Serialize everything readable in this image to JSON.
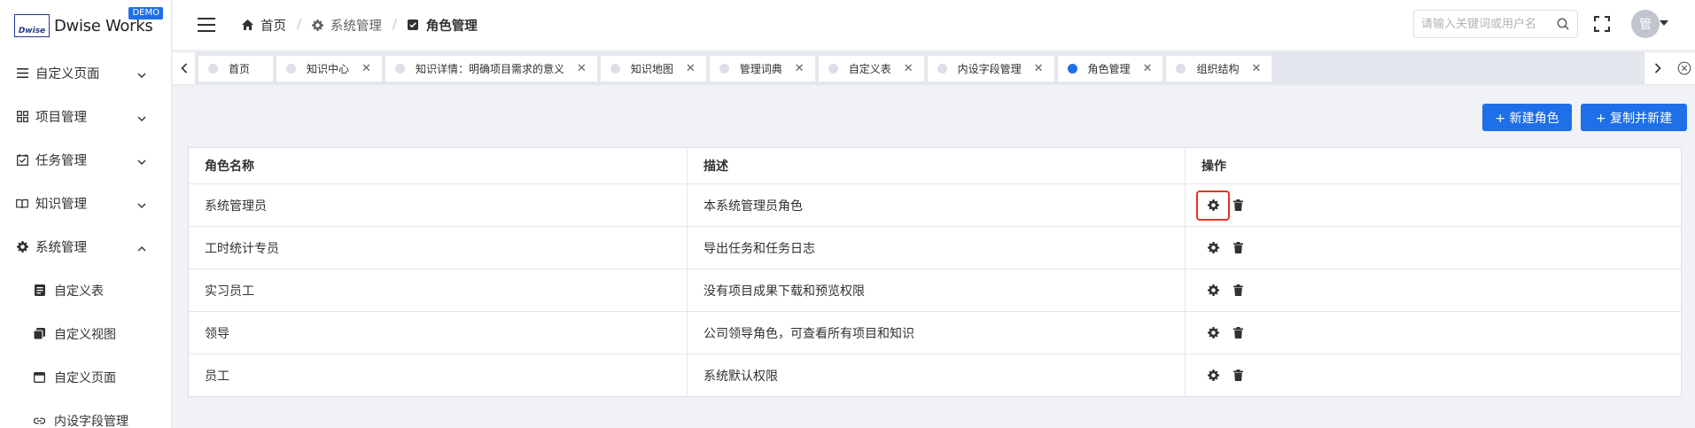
{
  "app": {
    "logo_mark": "Dwise",
    "logo_text": "Dwise Works",
    "demo_badge": "DEMO"
  },
  "sidebar": {
    "items": [
      {
        "label": "自定义页面",
        "icon": "menu-lines-icon",
        "expanded": false
      },
      {
        "label": "项目管理",
        "icon": "grid-icon",
        "expanded": false
      },
      {
        "label": "任务管理",
        "icon": "calendar-check-icon",
        "expanded": false
      },
      {
        "label": "知识管理",
        "icon": "book-open-icon",
        "expanded": false
      },
      {
        "label": "系统管理",
        "icon": "gear-icon",
        "expanded": true
      }
    ],
    "sub_items": [
      {
        "label": "自定义表",
        "icon": "document-icon"
      },
      {
        "label": "自定义视图",
        "icon": "copy-icon"
      },
      {
        "label": "自定义页面",
        "icon": "window-icon"
      },
      {
        "label": "内设字段管理",
        "icon": "link-icon"
      }
    ]
  },
  "header": {
    "breadcrumb": [
      {
        "label": "首页",
        "icon": "home-icon"
      },
      {
        "label": "系统管理",
        "icon": "gear-icon"
      },
      {
        "label": "角色管理",
        "icon": "checkbox-icon"
      }
    ],
    "search_placeholder": "请输入关键词或用户名",
    "avatar_text": "管"
  },
  "tabs": [
    {
      "label": "首页",
      "closable": false,
      "active": false
    },
    {
      "label": "知识中心",
      "closable": true,
      "active": false
    },
    {
      "label": "知识详情：明确项目需求的意义",
      "closable": true,
      "active": false
    },
    {
      "label": "知识地图",
      "closable": true,
      "active": false
    },
    {
      "label": "管理词典",
      "closable": true,
      "active": false
    },
    {
      "label": "自定义表",
      "closable": true,
      "active": false
    },
    {
      "label": "内设字段管理",
      "closable": true,
      "active": false
    },
    {
      "label": "角色管理",
      "closable": true,
      "active": true
    },
    {
      "label": "组织结构",
      "closable": true,
      "active": false
    }
  ],
  "toolbar": {
    "new_role_label": "+ 新建角色",
    "copy_new_label": "+ 复制并新建"
  },
  "table": {
    "headers": [
      "角色名称",
      "描述",
      "操作"
    ],
    "rows": [
      {
        "name": "系统管理员",
        "desc": "本系统管理员角色"
      },
      {
        "name": "工时统计专员",
        "desc": "导出任务和任务日志"
      },
      {
        "name": "实习员工",
        "desc": "没有项目成果下载和预览权限"
      },
      {
        "name": "领导",
        "desc": "公司领导角色，可查看所有项目和知识"
      },
      {
        "name": "员工",
        "desc": "系统默认权限"
      }
    ]
  },
  "colors": {
    "primary": "#1e6fe8",
    "highlight": "#e8331f"
  }
}
